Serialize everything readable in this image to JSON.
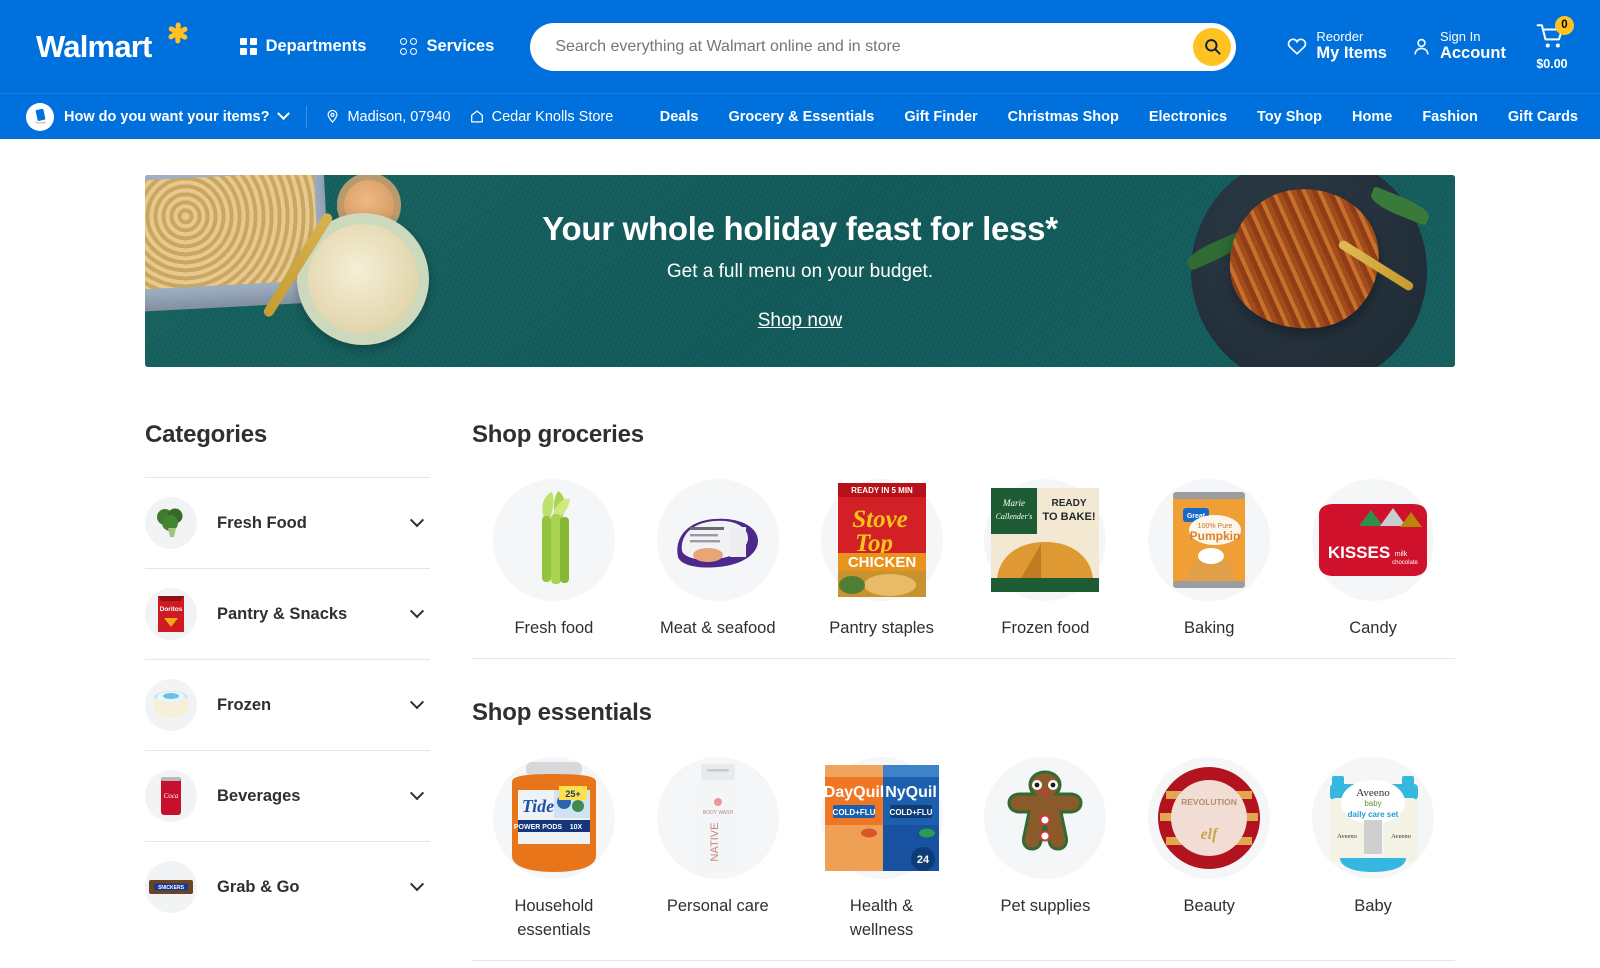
{
  "header": {
    "logo_text": "Walmart",
    "logo_icon": "walmart-spark-icon",
    "departments_label": "Departments",
    "departments_icon": "grid-squares-icon",
    "services_label": "Services",
    "services_icon": "grid-circles-icon",
    "search": {
      "placeholder": "Search everything at Walmart online and in store",
      "value": "",
      "icon": "search-icon"
    },
    "reorder": {
      "small": "Reorder",
      "big": "My Items",
      "icon": "heart-icon"
    },
    "account": {
      "small": "Sign In",
      "big": "Account",
      "icon": "user-icon"
    },
    "cart": {
      "count": "0",
      "amount": "$0.00",
      "icon": "shopping-cart-icon"
    }
  },
  "subnav": {
    "fulfillment_label": "How do you want your items?",
    "fulfillment_icon": "hand-holding-phone-icon",
    "chevron_icon": "chevron-down-icon",
    "location": "Madison, 07940",
    "location_icon": "map-pin-icon",
    "store": "Cedar Knolls Store",
    "store_icon": "store-home-icon",
    "links": [
      "Deals",
      "Grocery & Essentials",
      "Gift Finder",
      "Christmas Shop",
      "Electronics",
      "Toy Shop",
      "Home",
      "Fashion",
      "Gift Cards"
    ]
  },
  "hero": {
    "headline": "Your whole holiday feast for less*",
    "subhead": "Get a full menu on your budget.",
    "cta": "Shop now",
    "bg_color": "#14605f",
    "left_art": "green-bean-casserole-and-mashed-potatoes-image",
    "right_art": "spiral-sliced-ham-on-plate-image"
  },
  "sidebar": {
    "title": "Categories",
    "items": [
      {
        "label": "Fresh Food",
        "icon": "broccoli-thumbnail"
      },
      {
        "label": "Pantry & Snacks",
        "icon": "doritos-bag-thumbnail"
      },
      {
        "label": "Frozen",
        "icon": "ice-cream-tub-thumbnail"
      },
      {
        "label": "Beverages",
        "icon": "coca-cola-can-thumbnail"
      },
      {
        "label": "Grab & Go",
        "icon": "snickers-bar-thumbnail"
      }
    ]
  },
  "groceries": {
    "title": "Shop groceries",
    "tiles": [
      {
        "label": "Fresh food",
        "icon": "celery-stalks-image"
      },
      {
        "label": "Meat & seafood",
        "icon": "packaged-turkey-image"
      },
      {
        "label": "Pantry staples",
        "icon": "stove-top-stuffing-box-image"
      },
      {
        "label": "Frozen food",
        "icon": "marie-callenders-pumpkin-pie-image"
      },
      {
        "label": "Baking",
        "icon": "great-value-pumpkin-can-image"
      },
      {
        "label": "Candy",
        "icon": "hersheys-kisses-bag-image"
      }
    ]
  },
  "essentials": {
    "title": "Shop essentials",
    "tiles": [
      {
        "label": "Household essentials",
        "icon": "tide-pods-tub-image"
      },
      {
        "label": "Personal care",
        "icon": "native-body-wash-bottle-image"
      },
      {
        "label": "Health & wellness",
        "icon": "dayquil-nyquil-box-image"
      },
      {
        "label": "Pet supplies",
        "icon": "gingerbread-man-pet-toy-image"
      },
      {
        "label": "Beauty",
        "icon": "revolution-elf-powder-compact-image"
      },
      {
        "label": "Baby",
        "icon": "aveeno-baby-daily-care-set-image"
      }
    ]
  },
  "colors": {
    "walmart_blue": "#0071dc",
    "walmart_yellow": "#ffc220",
    "hero_teal": "#14605f",
    "text_dark": "#2e2f32"
  },
  "product_text": {
    "doritos": "Doritos",
    "coke": "Coca-Cola",
    "snickers": "SNICKERS",
    "stove_top_ready": "READY IN 5 MINUTES",
    "stove_top_1": "Stove",
    "stove_top_2": "Top",
    "stove_top_3": "CHICKEN",
    "marie": "Marie Callender's",
    "ready_to_bake": "READY TO BAKE!",
    "great_value": "Great Value",
    "pumpkin_pct": "100% Pure",
    "pumpkin": "Pumpkin",
    "kisses": "KISSES",
    "tide": "Tide",
    "tide_25": "25+",
    "native": "NATIVE",
    "dayquil": "DayQuil",
    "nyquil": "NyQuil",
    "cold_flu": "COLD+FLU",
    "revolution": "REVOLUTION",
    "elf": "elf",
    "aveeno": "Aveeno",
    "aveeno_sub": "baby"
  }
}
